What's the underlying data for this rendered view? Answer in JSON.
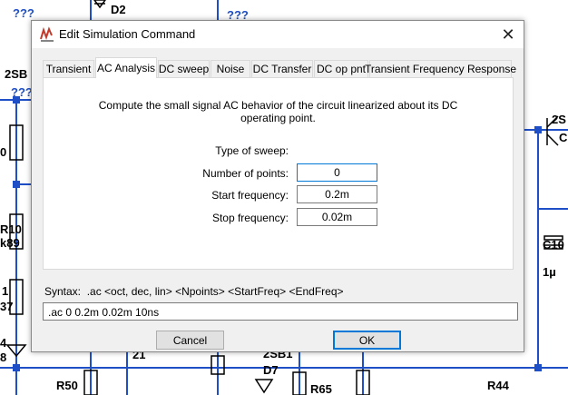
{
  "background": {
    "labels": {
      "q1": "???",
      "d2": "D2",
      "q2": "???",
      "sb": "2SB",
      "q3": "???",
      "r0": "0",
      "r10": "R10",
      "k89": "k89",
      "one": "1",
      "r37": "37",
      "four": "4",
      "eight": "8",
      "r50": "R50",
      "r21": "21",
      "d7": "D7",
      "r65": "R65",
      "c10": "C10",
      "cu": "1µ",
      "r44": "R44",
      "s2": "2S",
      "cq": "C",
      "sb2": "2SB1"
    }
  },
  "dialog": {
    "title": "Edit Simulation Command",
    "close_glyph": "✕",
    "tabs": [
      {
        "label": "Transient"
      },
      {
        "label": "AC Analysis"
      },
      {
        "label": "DC sweep"
      },
      {
        "label": "Noise"
      },
      {
        "label": "DC Transfer"
      },
      {
        "label": "DC op pnt"
      },
      {
        "label": "Transient Frequency Response"
      }
    ],
    "active_tab": "AC Analysis",
    "description_line1": "Compute the small signal AC behavior of the circuit linearized about its DC",
    "description_line2": "operating point.",
    "fields": {
      "type_of_sweep": {
        "label": "Type of sweep:",
        "value": ""
      },
      "number_of_points": {
        "label": "Number of points:",
        "value": "0"
      },
      "start_frequency": {
        "label": "Start frequency:",
        "value": "0.2m"
      },
      "stop_frequency": {
        "label": "Stop frequency:",
        "value": "0.02m"
      }
    },
    "syntax": "Syntax:  .ac <oct, dec, lin> <Npoints> <StartFreq> <EndFreq>",
    "command": ".ac 0 0.2m 0.02m 10ns",
    "cancel_label": "Cancel",
    "ok_label": "OK"
  },
  "colors": {
    "accent": "#0078d7",
    "schematic_wire": "#1f4fc7",
    "node": "#1f4fc7"
  }
}
